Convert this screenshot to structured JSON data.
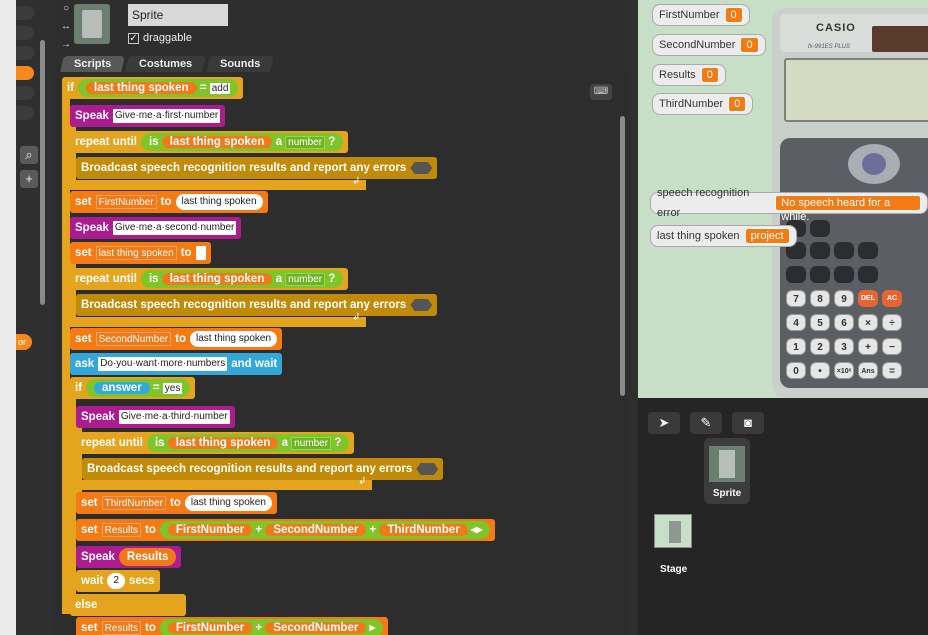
{
  "sprite": {
    "name": "Sprite",
    "draggable_label": "draggable",
    "draggable_checked": "✓"
  },
  "tabs": [
    {
      "label": "Scripts"
    },
    {
      "label": "Costumes"
    },
    {
      "label": "Sounds"
    }
  ],
  "script": {
    "if1": {
      "kw": "if",
      "reporter": "last thing spoken",
      "eq": "=",
      "value": "add"
    },
    "speak1": {
      "kw": "Speak",
      "text": "Give·me·a·first·number"
    },
    "repeat1": {
      "kw": "repeat until",
      "is": "is",
      "reporter": "last thing spoken",
      "a": "a",
      "type": "number",
      "q": "?"
    },
    "bcast1": {
      "text": "Broadcast speech recognition results and report any errors"
    },
    "set1": {
      "kw": "set",
      "var": "FirstNumber",
      "to": "to",
      "reporter": "last thing spoken"
    },
    "speak2": {
      "kw": "Speak",
      "text": "Give·me·a·second·number"
    },
    "set2": {
      "kw": "set",
      "var": "last thing spoken",
      "to": "to",
      "value": ""
    },
    "repeat2": {
      "kw": "repeat until",
      "is": "is",
      "reporter": "last thing spoken",
      "a": "a",
      "type": "number",
      "q": "?"
    },
    "bcast2": {
      "text": "Broadcast speech recognition results and report any errors"
    },
    "set3": {
      "kw": "set",
      "var": "SecondNumber",
      "to": "to",
      "reporter": "last thing spoken"
    },
    "ask": {
      "kw": "ask",
      "text": "Do·you·want·more·numbers",
      "tail": "and wait"
    },
    "if2": {
      "kw": "if",
      "reporter": "answer",
      "eq": "=",
      "value": "yes"
    },
    "speak3": {
      "kw": "Speak",
      "text": "Give·me·a·third·number"
    },
    "repeat3": {
      "kw": "repeat until",
      "is": "is",
      "reporter": "last thing spoken",
      "a": "a",
      "type": "number",
      "q": "?"
    },
    "bcast3": {
      "text": "Broadcast speech recognition results and report any errors"
    },
    "set4": {
      "kw": "set",
      "var": "ThirdNumber",
      "to": "to",
      "reporter": "last thing spoken"
    },
    "set5": {
      "kw": "set",
      "var": "Results",
      "to": "to",
      "a": "FirstNumber",
      "plus": "+",
      "b": "SecondNumber",
      "c": "ThirdNumber"
    },
    "speak4": {
      "kw": "Speak",
      "reporter": "Results"
    },
    "wait": {
      "kw": "wait",
      "value": "2",
      "unit": "secs"
    },
    "else": {
      "kw": "else"
    },
    "set6": {
      "kw": "set",
      "var": "Results",
      "to": "to",
      "a": "FirstNumber",
      "plus": "+",
      "b": "SecondNumber"
    }
  },
  "watchers": [
    {
      "label": "FirstNumber",
      "value": "0"
    },
    {
      "label": "SecondNumber",
      "value": "0"
    },
    {
      "label": "Results",
      "value": "0"
    },
    {
      "label": "ThirdNumber",
      "value": "0"
    },
    {
      "label": "speech recognition error",
      "value": "No speech heard for a while."
    },
    {
      "label": "last thing spoken",
      "value": "project"
    }
  ],
  "calculator": {
    "brand": "CASIO",
    "model": "fx-991ES PLUS",
    "keys": [
      "7",
      "8",
      "9",
      "DEL",
      "AC",
      "4",
      "5",
      "6",
      "×",
      "÷",
      "1",
      "2",
      "3",
      "+",
      "−",
      "0",
      "•",
      "×10ˣ",
      "Ans",
      "="
    ]
  },
  "corral": {
    "sprite_label": "Sprite",
    "stage_label": "Stage"
  },
  "accent": {
    "control": "#e5a41e",
    "variable": "#f47b14",
    "operator": "#7fc428",
    "looks": "#ac1c90",
    "sensing": "#34a8db"
  }
}
